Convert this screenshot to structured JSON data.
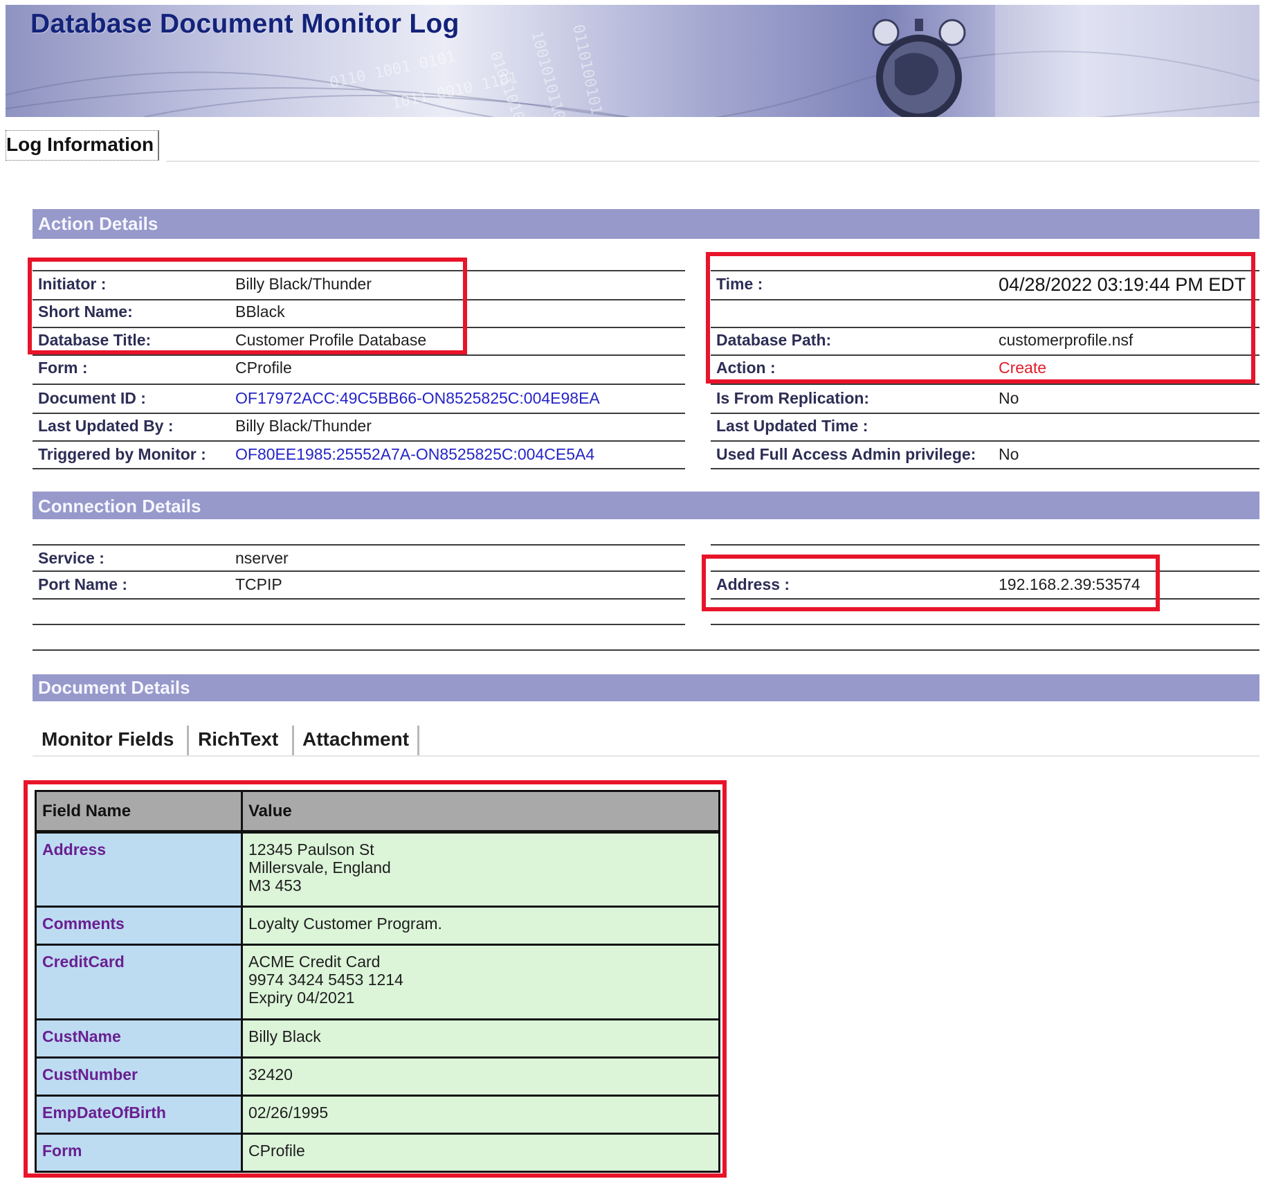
{
  "banner": {
    "title": "Database Document Monitor Log"
  },
  "top_tab": {
    "label": "Log Information"
  },
  "action_details": {
    "header": "Action Details",
    "left": [
      {
        "label": "Initiator :",
        "value": "Billy Black/Thunder"
      },
      {
        "label": "Short Name:",
        "value": "BBlack"
      },
      {
        "label": "Database Title:",
        "value": "Customer Profile Database"
      },
      {
        "label": "Form :",
        "value": "CProfile"
      },
      {
        "label": "Document ID :",
        "value": "OF17972ACC:49C5BB66-ON8525825C:004E98EA"
      },
      {
        "label": "Last Updated By :",
        "value": "Billy Black/Thunder"
      },
      {
        "label": "Triggered by Monitor :",
        "value": "OF80EE1985:25552A7A-ON8525825C:004CE5A4"
      }
    ],
    "right": [
      {
        "label": "Time :",
        "value": "04/28/2022 03:19:44 PM EDT"
      },
      {
        "label": "Database Path:",
        "value": "customerprofile.nsf"
      },
      {
        "label": "Action :",
        "value": "Create"
      },
      {
        "label": "Is From Replication:",
        "value": "No"
      },
      {
        "label": "Last Updated Time :",
        "value": ""
      },
      {
        "label": "Used Full Access Admin privilege:",
        "value": "No"
      }
    ]
  },
  "connection_details": {
    "header": "Connection Details",
    "left": [
      {
        "label": "Service :",
        "value": "nserver"
      },
      {
        "label": "Port Name :",
        "value": "TCPIP"
      }
    ],
    "right": [
      {
        "label": "Address :",
        "value": "192.168.2.39:53574"
      }
    ]
  },
  "document_details": {
    "header": "Document Details",
    "tabs": [
      "Monitor Fields",
      "RichText",
      "Attachment"
    ],
    "active_tab": "Monitor Fields",
    "table": {
      "headers": [
        "Field Name",
        "Value"
      ],
      "rows": [
        {
          "field": "Address",
          "value": "12345 Paulson St\nMillersvale, England\nM3 453"
        },
        {
          "field": "Comments",
          "value": "Loyalty Customer Program."
        },
        {
          "field": "CreditCard",
          "value": "ACME Credit Card\n9974 3424 5453 1214\nExpiry 04/2021"
        },
        {
          "field": "CustName",
          "value": "Billy Black"
        },
        {
          "field": "CustNumber",
          "value": "32420"
        },
        {
          "field": "EmpDateOfBirth",
          "value": "02/26/1995"
        },
        {
          "field": "Form",
          "value": "CProfile"
        }
      ]
    }
  },
  "colors": {
    "section_bar": "#9699ca",
    "highlight": "#e8142a",
    "link": "#2424c8",
    "field_name_bg": "#bddcf2",
    "field_value_bg": "#dcf5d9"
  }
}
